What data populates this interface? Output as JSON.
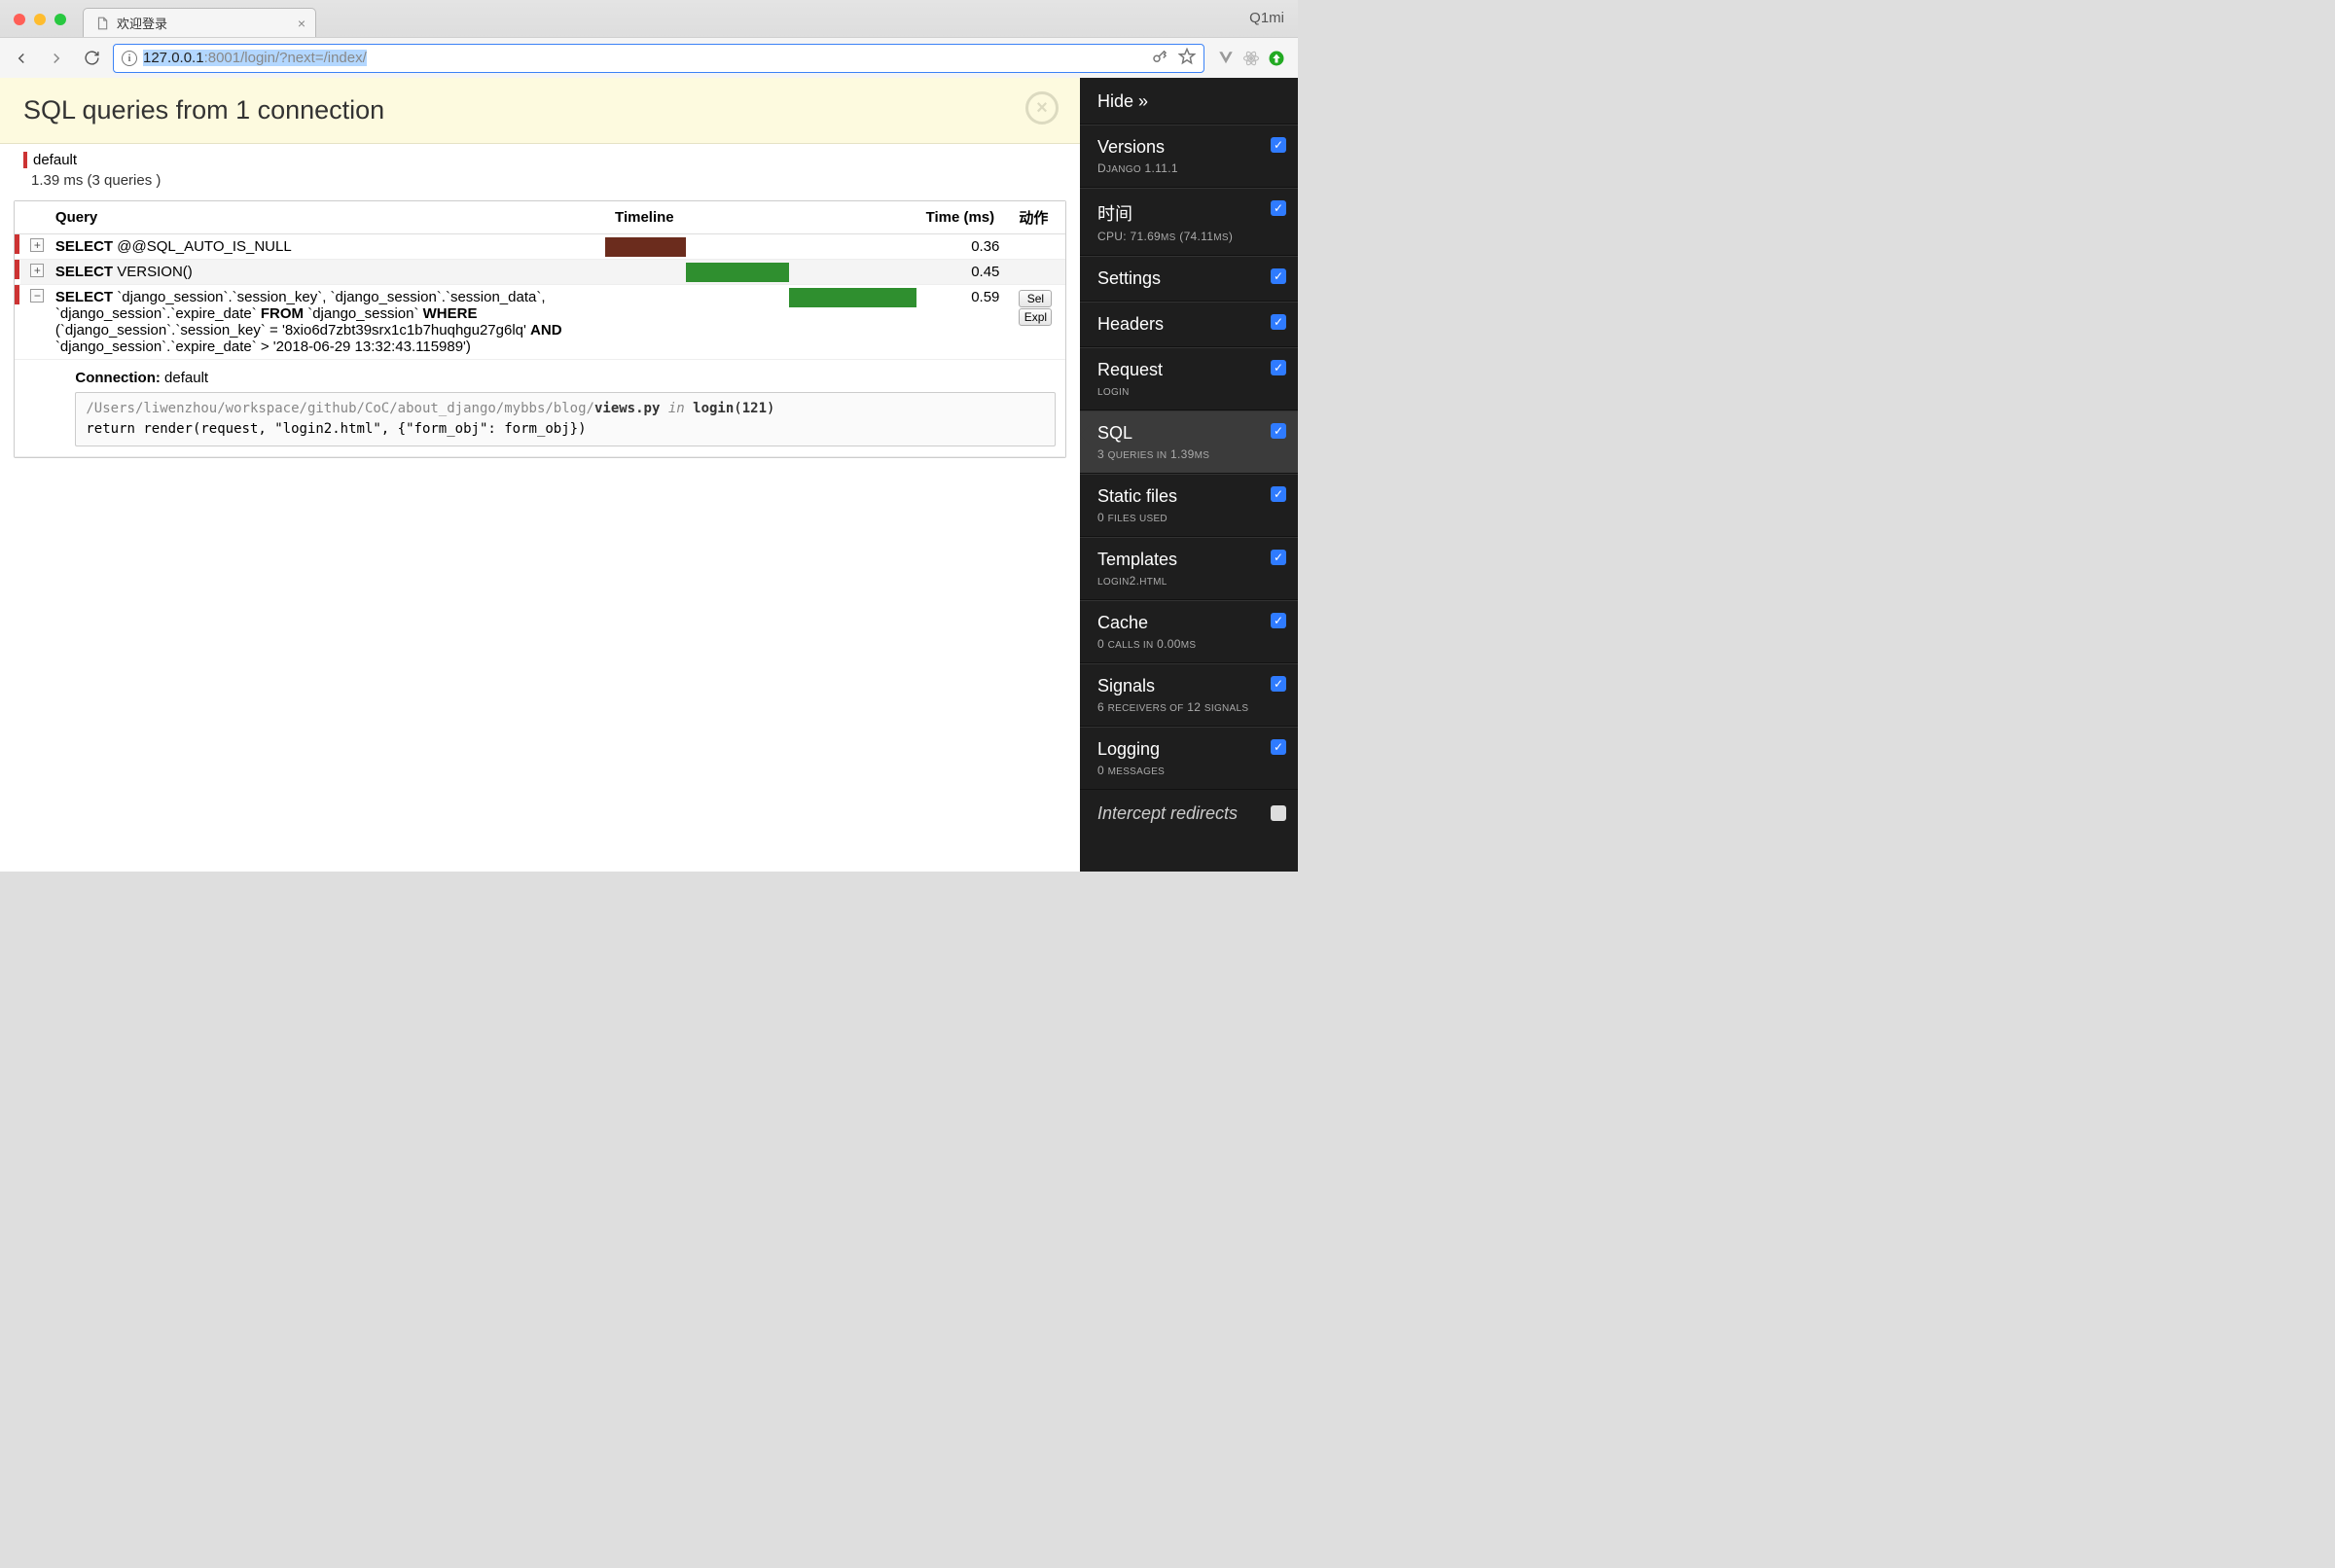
{
  "browser": {
    "tab_title": "欢迎登录",
    "profile": "Q1mi",
    "url_host": "127.0.0.1",
    "url_rest": ":8001/login/?next=/index/"
  },
  "panel": {
    "title": "SQL queries from 1 connection",
    "connection_name": "default",
    "connection_summary": "1.39 ms (3 queries )",
    "headers": {
      "query": "Query",
      "timeline": "Timeline",
      "time": "Time (ms)",
      "action": "动作"
    },
    "rows": [
      {
        "toggle": "+",
        "query_html": "<span class='sql-kw'>SELECT</span> @@SQL_AUTO_IS_NULL",
        "time": "0.36",
        "tl_left_pct": 0,
        "tl_width_pct": 26,
        "tl_class": "tl-brown",
        "actions": []
      },
      {
        "toggle": "+",
        "query_html": "<span class='sql-kw'>SELECT</span> VERSION()",
        "time": "0.45",
        "tl_left_pct": 26,
        "tl_width_pct": 33,
        "tl_class": "tl-green",
        "actions": []
      },
      {
        "toggle": "−",
        "query_html": "<span class='sql-kw'>SELECT</span> `django_session`.`session_key`, `django_session`.`session_data`, `django_session`.`expire_date` <span class='sql-kw'>FROM</span> `django_session` <span class='sql-kw'>WHERE</span> (`django_session`.`session_key` = '8xio6d7zbt39srx1c1b7huqhgu27g6lq' <span class='sql-kw'>AND</span> `django_session`.`expire_date` > '2018-06-29 13:32:43.115989')",
        "time": "0.59",
        "tl_left_pct": 59,
        "tl_width_pct": 41,
        "tl_class": "tl-green",
        "actions": [
          "Sel",
          "Expl"
        ]
      }
    ],
    "expanded": {
      "conn_label": "Connection:",
      "conn_value": "default",
      "trace_path_dim": "/Users/liwenzhou/workspace/github/CoC/about_django/mybbs/blog/",
      "trace_file": "views.py",
      "trace_in": "in",
      "trace_func": "login",
      "trace_line": "121",
      "trace_code": "    return render(request, \"login2.html\", {\"form_obj\": form_obj})"
    }
  },
  "toolbar": {
    "hide_label": "Hide »",
    "panels": [
      {
        "title": "Versions",
        "sub_html": "D<span class='sc'>JANGO</span> 1.11.1",
        "checked": true
      },
      {
        "title": "时间",
        "sub_html": "CPU: 71.69<span class='sc'>MS</span> (74.11<span class='sc'>MS</span>)",
        "checked": true
      },
      {
        "title": "Settings",
        "sub_html": "",
        "checked": true
      },
      {
        "title": "Headers",
        "sub_html": "",
        "checked": true
      },
      {
        "title": "Request",
        "sub_html": "<span class='sc'>LOGIN</span>",
        "checked": true
      },
      {
        "title": "SQL",
        "sub_html": "3 <span class='sc'>QUERIES IN</span> 1.39<span class='sc'>MS</span>",
        "checked": true,
        "active": true
      },
      {
        "title": "Static files",
        "sub_html": "0 <span class='sc'>FILES USED</span>",
        "checked": true
      },
      {
        "title": "Templates",
        "sub_html": "<span class='sc'>LOGIN</span>2.<span class='sc'>HTML</span>",
        "checked": true
      },
      {
        "title": "Cache",
        "sub_html": "0 <span class='sc'>CALLS IN</span> 0.00<span class='sc'>MS</span>",
        "checked": true
      },
      {
        "title": "Signals",
        "sub_html": "6 <span class='sc'>RECEIVERS OF</span> 12 <span class='sc'>SIGNALS</span>",
        "checked": true
      },
      {
        "title": "Logging",
        "sub_html": "0 <span class='sc'>MESSAGES</span>",
        "checked": true
      }
    ],
    "intercept_label": "Intercept redirects",
    "intercept_checked": false
  }
}
